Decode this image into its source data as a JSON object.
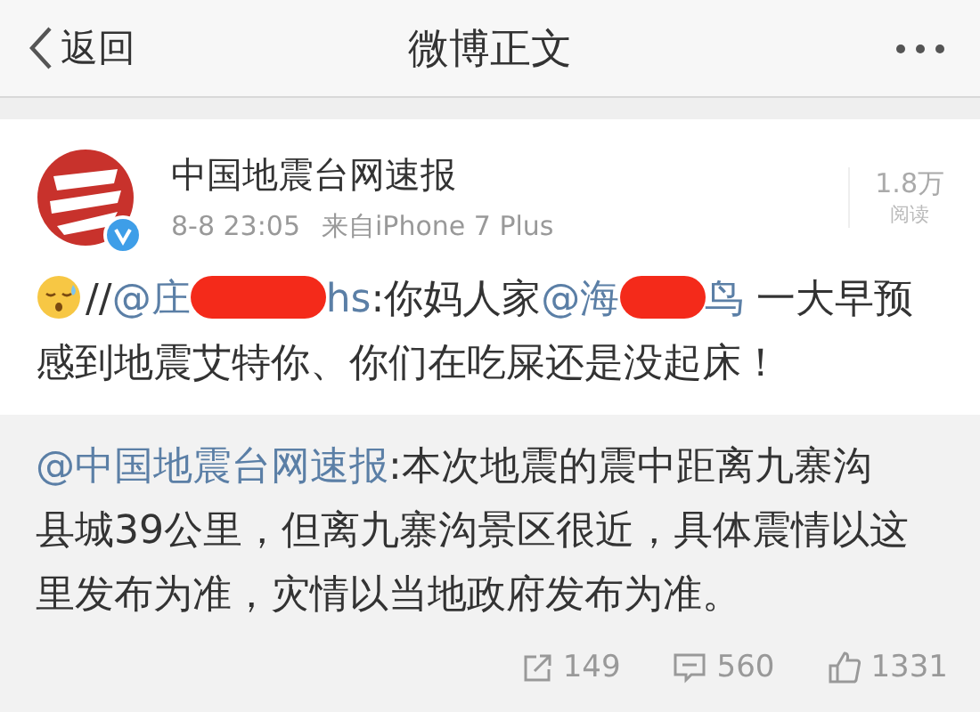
{
  "nav": {
    "back": "返回",
    "title": "微博正文"
  },
  "post": {
    "author": "中国地震台网速报",
    "verified": true,
    "time": "8-8 23:05",
    "source": "来自iPhone 7 Plus",
    "reads": "1.8万",
    "reads_label": "阅读",
    "segments": [
      {
        "kind": "emoji"
      },
      {
        "kind": "text",
        "text": "//"
      },
      {
        "kind": "mention",
        "text": "@庄"
      },
      {
        "kind": "redaction"
      },
      {
        "kind": "mention",
        "text": "hs"
      },
      {
        "kind": "text",
        "text": ":你妈人家"
      },
      {
        "kind": "mention",
        "text": "@海"
      },
      {
        "kind": "redaction"
      },
      {
        "kind": "mention",
        "text": "鸟"
      },
      {
        "kind": "text",
        "text": " 一大早预"
      },
      {
        "kind": "break"
      },
      {
        "kind": "text",
        "text": "感到地震艾特你、你们在吃屎还是没起床！"
      }
    ]
  },
  "quoted": {
    "mention": "@中国地震台网速报",
    "text": ":本次地震的震中距离九寨沟县城39公里，但离九寨沟景区很近，具体震情以这里发布为准，灾情以当地政府发布为准。"
  },
  "actions": [
    {
      "kind": "repost",
      "count": "149"
    },
    {
      "kind": "comment",
      "count": "560"
    },
    {
      "kind": "like",
      "count": "1331"
    }
  ]
}
